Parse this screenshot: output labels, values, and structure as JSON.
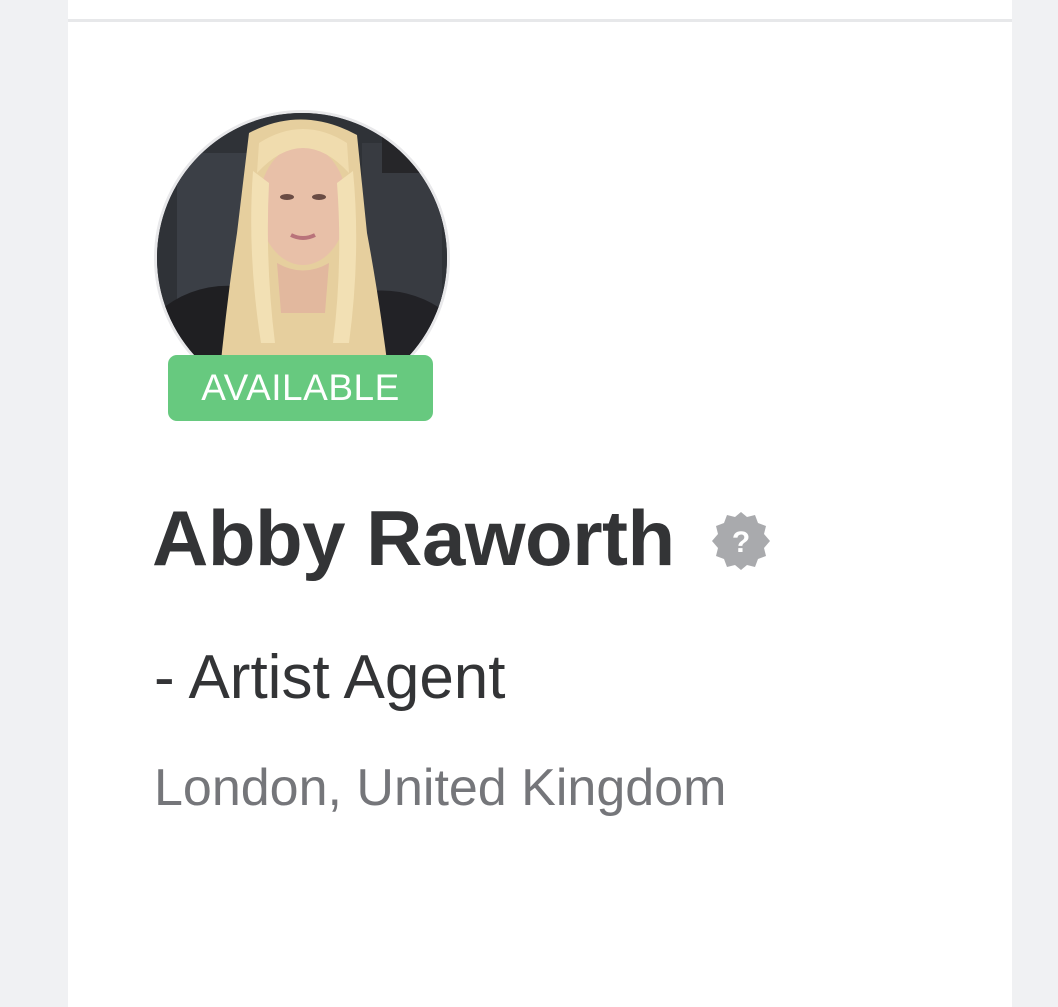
{
  "profile": {
    "status_badge": "AVAILABLE",
    "name": "Abby Raworth",
    "title": "- Artist Agent",
    "location": "London, United Kingdom",
    "avatar_icon": "profile-photo",
    "help_icon": "question-badge-icon"
  },
  "colors": {
    "badge_bg": "#67c97f",
    "name_text": "#333436",
    "location_text": "#75767a",
    "page_bg": "#f0f1f3"
  }
}
